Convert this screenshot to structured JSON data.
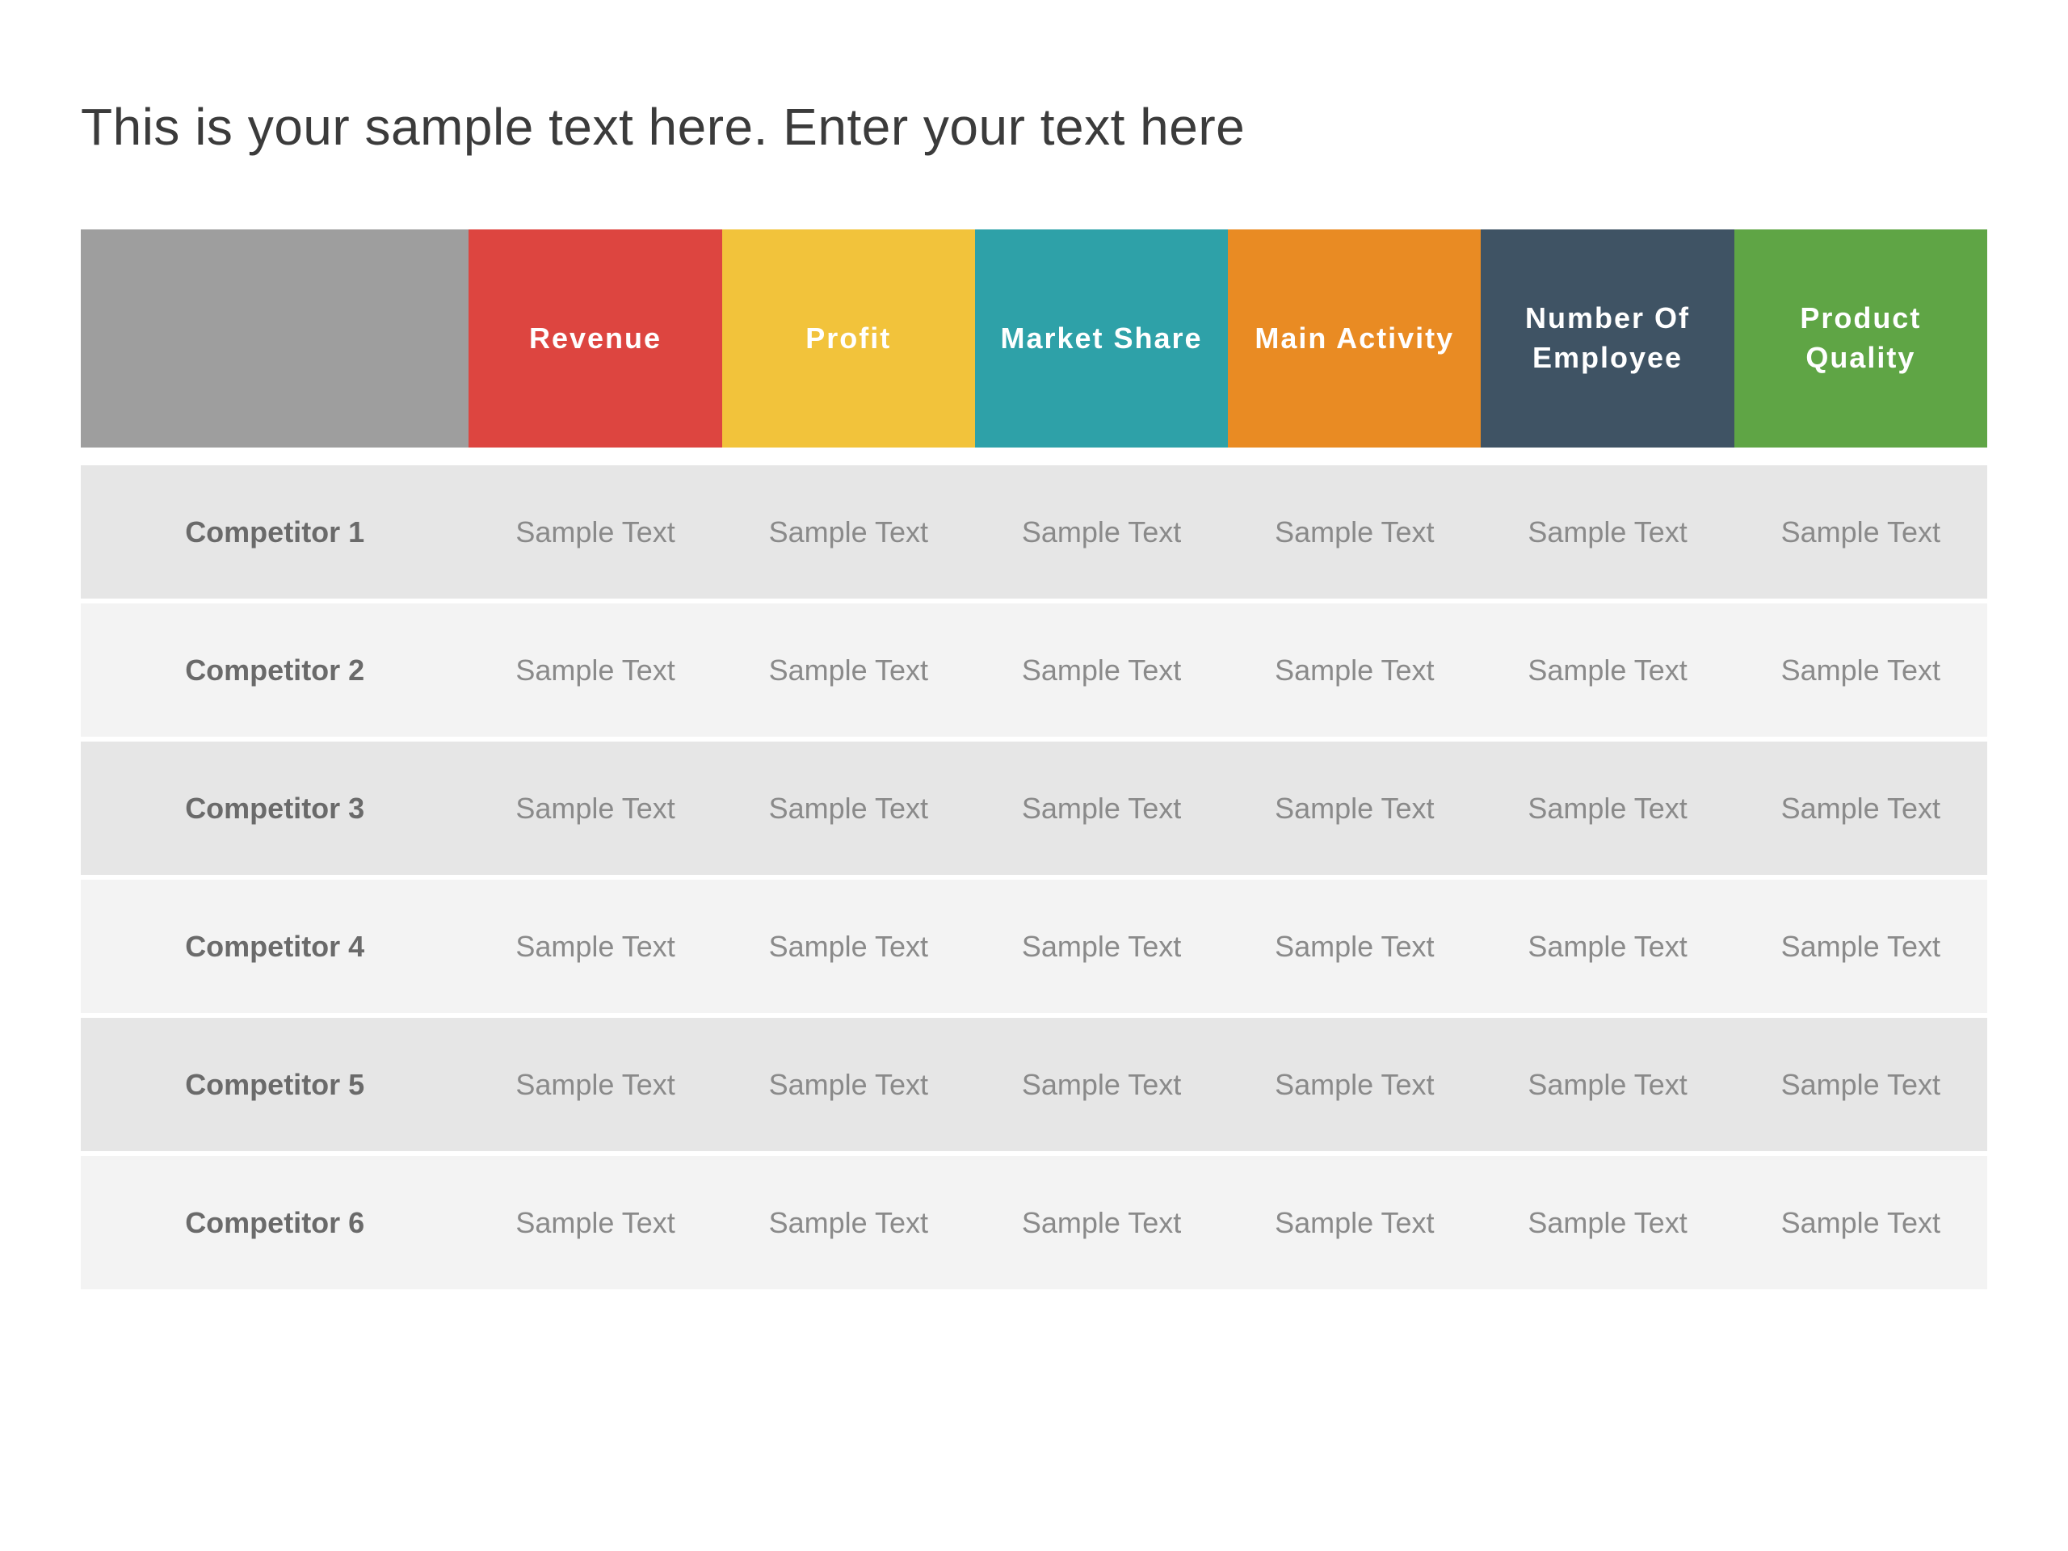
{
  "title": "This is your sample text here. Enter your text here",
  "chart_data": {
    "type": "table",
    "columns": [
      {
        "label": "Revenue"
      },
      {
        "label": "Profit"
      },
      {
        "label": "Market Share"
      },
      {
        "label": "Main Activity"
      },
      {
        "label": "Number Of Employee"
      },
      {
        "label": "Product Quality"
      }
    ],
    "rows": [
      {
        "label": "Competitor 1",
        "cells": [
          "Sample Text",
          "Sample Text",
          "Sample Text",
          "Sample Text",
          "Sample Text",
          "Sample Text"
        ]
      },
      {
        "label": "Competitor 2",
        "cells": [
          "Sample Text",
          "Sample Text",
          "Sample Text",
          "Sample Text",
          "Sample Text",
          "Sample Text"
        ]
      },
      {
        "label": "Competitor 3",
        "cells": [
          "Sample Text",
          "Sample Text",
          "Sample Text",
          "Sample Text",
          "Sample Text",
          "Sample Text"
        ]
      },
      {
        "label": "Competitor 4",
        "cells": [
          "Sample Text",
          "Sample Text",
          "Sample Text",
          "Sample Text",
          "Sample Text",
          "Sample Text"
        ]
      },
      {
        "label": "Competitor 5",
        "cells": [
          "Sample Text",
          "Sample Text",
          "Sample Text",
          "Sample Text",
          "Sample Text",
          "Sample Text"
        ]
      },
      {
        "label": "Competitor 6",
        "cells": [
          "Sample Text",
          "Sample Text",
          "Sample Text",
          "Sample Text",
          "Sample Text",
          "Sample Text"
        ]
      }
    ]
  },
  "colors": {
    "header_blank": "#9e9e9e",
    "revenue": "#dd4540",
    "profit": "#f2c33b",
    "market_share": "#2ea1a8",
    "main_activity": "#e98b23",
    "number_of_employee": "#3f5364",
    "product_quality": "#5fa545",
    "row_even": "#e6e6e6",
    "row_odd": "#f3f3f3"
  }
}
